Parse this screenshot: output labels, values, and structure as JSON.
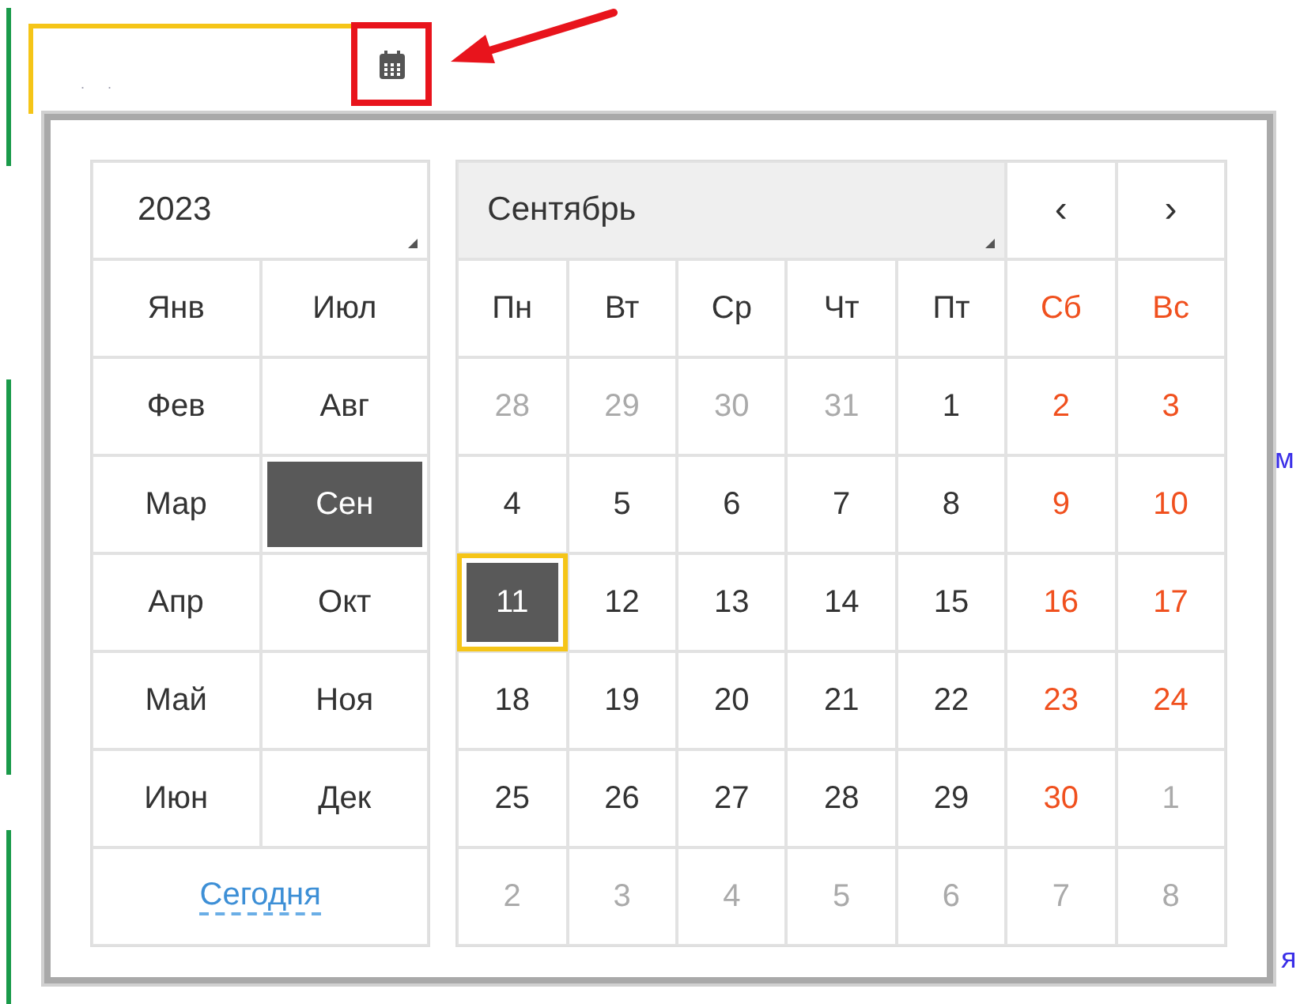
{
  "date_field": {
    "value": ". ."
  },
  "background_fragments": [
    "м",
    "я"
  ],
  "calendar": {
    "year": "2023",
    "months": [
      {
        "label": "Янв",
        "selected": false
      },
      {
        "label": "Июл",
        "selected": false
      },
      {
        "label": "Фев",
        "selected": false
      },
      {
        "label": "Авг",
        "selected": false
      },
      {
        "label": "Мар",
        "selected": false
      },
      {
        "label": "Сен",
        "selected": true
      },
      {
        "label": "Апр",
        "selected": false
      },
      {
        "label": "Окт",
        "selected": false
      },
      {
        "label": "Май",
        "selected": false
      },
      {
        "label": "Ноя",
        "selected": false
      },
      {
        "label": "Июн",
        "selected": false
      },
      {
        "label": "Дек",
        "selected": false
      }
    ],
    "today_link": "Сегодня",
    "month_select": "Сентябрь",
    "prev": "‹",
    "next": "›",
    "weekdays": [
      {
        "label": "Пн",
        "weekend": false
      },
      {
        "label": "Вт",
        "weekend": false
      },
      {
        "label": "Ср",
        "weekend": false
      },
      {
        "label": "Чт",
        "weekend": false
      },
      {
        "label": "Пт",
        "weekend": false
      },
      {
        "label": "Сб",
        "weekend": true
      },
      {
        "label": "Вс",
        "weekend": true
      }
    ],
    "weeks": [
      [
        {
          "day": "28",
          "kind": "other",
          "selected": false
        },
        {
          "day": "29",
          "kind": "other",
          "selected": false
        },
        {
          "day": "30",
          "kind": "other",
          "selected": false
        },
        {
          "day": "31",
          "kind": "other",
          "selected": false
        },
        {
          "day": "1",
          "kind": "current",
          "weekend": false,
          "selected": false
        },
        {
          "day": "2",
          "kind": "current",
          "weekend": true,
          "selected": false
        },
        {
          "day": "3",
          "kind": "current",
          "weekend": true,
          "selected": false
        }
      ],
      [
        {
          "day": "4",
          "kind": "current",
          "weekend": false,
          "selected": false
        },
        {
          "day": "5",
          "kind": "current",
          "weekend": false,
          "selected": false
        },
        {
          "day": "6",
          "kind": "current",
          "weekend": false,
          "selected": false
        },
        {
          "day": "7",
          "kind": "current",
          "weekend": false,
          "selected": false
        },
        {
          "day": "8",
          "kind": "current",
          "weekend": false,
          "selected": false
        },
        {
          "day": "9",
          "kind": "current",
          "weekend": true,
          "selected": false
        },
        {
          "day": "10",
          "kind": "current",
          "weekend": true,
          "selected": false
        }
      ],
      [
        {
          "day": "11",
          "kind": "current",
          "weekend": false,
          "selected": true
        },
        {
          "day": "12",
          "kind": "current",
          "weekend": false,
          "selected": false
        },
        {
          "day": "13",
          "kind": "current",
          "weekend": false,
          "selected": false
        },
        {
          "day": "14",
          "kind": "current",
          "weekend": false,
          "selected": false
        },
        {
          "day": "15",
          "kind": "current",
          "weekend": false,
          "selected": false
        },
        {
          "day": "16",
          "kind": "current",
          "weekend": true,
          "selected": false
        },
        {
          "day": "17",
          "kind": "current",
          "weekend": true,
          "selected": false
        }
      ],
      [
        {
          "day": "18",
          "kind": "current",
          "weekend": false,
          "selected": false
        },
        {
          "day": "19",
          "kind": "current",
          "weekend": false,
          "selected": false
        },
        {
          "day": "20",
          "kind": "current",
          "weekend": false,
          "selected": false
        },
        {
          "day": "21",
          "kind": "current",
          "weekend": false,
          "selected": false
        },
        {
          "day": "22",
          "kind": "current",
          "weekend": false,
          "selected": false
        },
        {
          "day": "23",
          "kind": "current",
          "weekend": true,
          "selected": false
        },
        {
          "day": "24",
          "kind": "current",
          "weekend": true,
          "selected": false
        }
      ],
      [
        {
          "day": "25",
          "kind": "current",
          "weekend": false,
          "selected": false
        },
        {
          "day": "26",
          "kind": "current",
          "weekend": false,
          "selected": false
        },
        {
          "day": "27",
          "kind": "current",
          "weekend": false,
          "selected": false
        },
        {
          "day": "28",
          "kind": "current",
          "weekend": false,
          "selected": false
        },
        {
          "day": "29",
          "kind": "current",
          "weekend": false,
          "selected": false
        },
        {
          "day": "30",
          "kind": "current",
          "weekend": true,
          "selected": false
        },
        {
          "day": "1",
          "kind": "other",
          "selected": false
        }
      ],
      [
        {
          "day": "2",
          "kind": "other",
          "selected": false
        },
        {
          "day": "3",
          "kind": "other",
          "selected": false
        },
        {
          "day": "4",
          "kind": "other",
          "selected": false
        },
        {
          "day": "5",
          "kind": "other",
          "selected": false
        },
        {
          "day": "6",
          "kind": "other",
          "selected": false
        },
        {
          "day": "7",
          "kind": "other",
          "selected": false
        },
        {
          "day": "8",
          "kind": "other",
          "selected": false
        }
      ]
    ]
  }
}
